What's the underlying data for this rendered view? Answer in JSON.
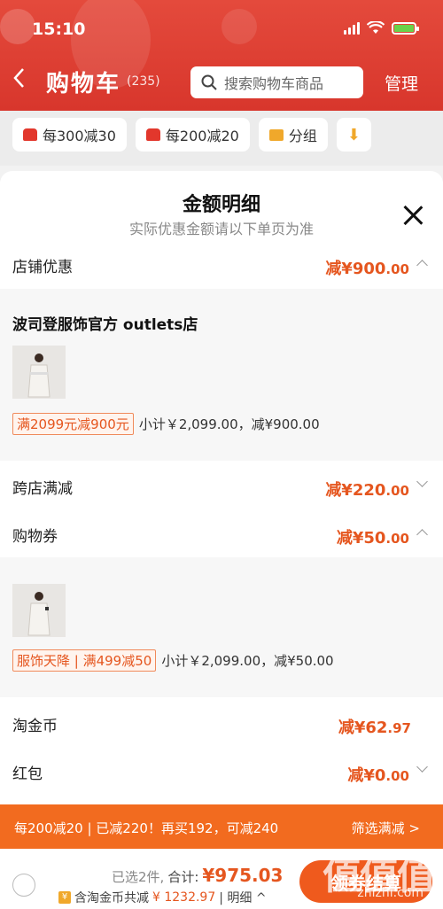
{
  "status_bar": {
    "time": "15:10"
  },
  "header": {
    "title": "购物车",
    "count": "(235)",
    "search_placeholder": "搜索购物车商品",
    "manage_label": "管理"
  },
  "filter_chips": [
    {
      "label": "每300减30"
    },
    {
      "label": "每200减20"
    },
    {
      "label": "分组"
    }
  ],
  "sheet": {
    "title": "金额明细",
    "subtitle": "实际优惠金额请以下单页为准",
    "store_discount": {
      "label": "店铺优惠",
      "prefix": "减¥",
      "amount": "900",
      "decimals": ".00"
    },
    "store_detail": {
      "shop_name": "波司登服饰官方 outlets店",
      "promo_tag": "满2099元减900元",
      "summary": "小计￥2,099.00，减¥900.00"
    },
    "cross_store": {
      "label": "跨店满减",
      "prefix": "减¥",
      "amount": "220",
      "decimals": ".00"
    },
    "coupon": {
      "label": "购物券",
      "prefix": "减¥",
      "amount": "50",
      "decimals": ".00"
    },
    "coupon_detail": {
      "promo_tag": "服饰天降 | 满499减50",
      "summary": "小计￥2,099.00，减¥50.00"
    },
    "taojinbi": {
      "label": "淘金币",
      "prefix": "减¥",
      "amount": "62",
      "decimals": ".97"
    },
    "hongbao": {
      "label": "红包",
      "prefix": "减¥",
      "amount": "0",
      "decimals": ".00"
    }
  },
  "banner": {
    "text": "每200减20 | 已减220！再买192，可减240",
    "link": "筛选满减 >"
  },
  "bottom_bar": {
    "selected": "已选2件,",
    "total_label": "合计:",
    "total_prefix": "¥",
    "total_amount": "975.03",
    "coin_icon": "¥",
    "discount_prefix": "含淘金币共减",
    "discount_amount": "¥ 1232.97",
    "detail_link": "| 明细 ^",
    "checkout_label": "领券结算"
  },
  "watermark": {
    "logo": "值值值",
    "site": "zhizhi.com"
  },
  "colors": {
    "accent": "#e5561f",
    "header_red": "#e44a3c",
    "banner_orange": "#f26b1f"
  }
}
